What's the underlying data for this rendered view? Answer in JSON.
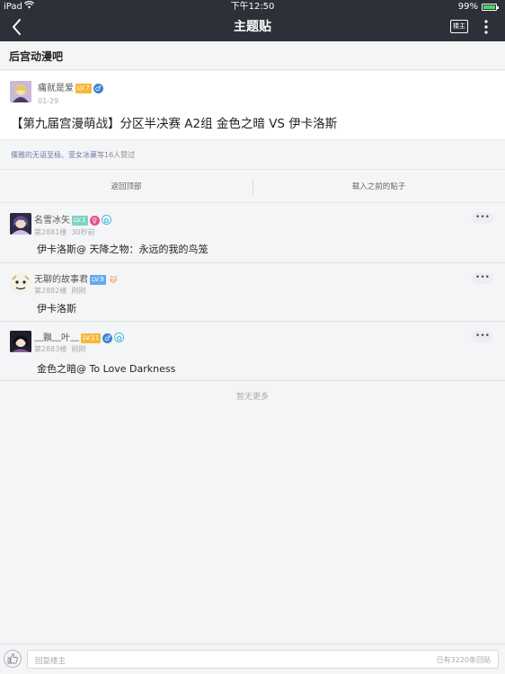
{
  "status_bar": {
    "device": "iPad",
    "time": "下午12:50",
    "battery": "99%"
  },
  "nav": {
    "title": "主题贴",
    "owner_label": "楼主",
    "back_icon": "back-chevron-icon",
    "more_icon": "vertical-dots-icon"
  },
  "forum": {
    "name": "后宫动漫吧"
  },
  "op": {
    "username": "痛就是爱",
    "level": "LV.7",
    "level_color": "#f5b83c",
    "gender_icon": "male-icon",
    "date": "01-29",
    "title": "【第九届宫漫萌战】分区半决赛 A2组 金色之暗 VS 伊卡洛斯"
  },
  "likes": {
    "users": "儒雅的无语至极、萱女冰菓",
    "suffix": "等16人赞过"
  },
  "actions": {
    "back_top": "返回顶部",
    "load_prev": "载入之前的贴子"
  },
  "replies": [
    {
      "username": "名雪冰矢",
      "level": "LV.1",
      "level_color": "#7fd3c4",
      "floor": "第2881楼",
      "time": "30秒前",
      "content": "伊卡洛斯@ 天降之物：永远的我的鸟笼",
      "more": "•••"
    },
    {
      "username": "无聊的故事君",
      "level": "LV.9",
      "level_color": "#66a8f0",
      "floor": "第2882楼",
      "time": "刚刚",
      "content": "伊卡洛斯",
      "more": "•••"
    },
    {
      "username": "﹏飘﹏叶﹏",
      "level": "LV.11",
      "level_color": "#f5b83c",
      "floor": "第2883楼",
      "time": "刚刚",
      "content": "金色之暗@ To Love Darkness",
      "more": "•••"
    }
  ],
  "no_more": "暂无更多",
  "bottom": {
    "placeholder": "回复楼主",
    "reply_count": "已有3220条回贴",
    "like_icon": "thumbs-up-icon"
  }
}
